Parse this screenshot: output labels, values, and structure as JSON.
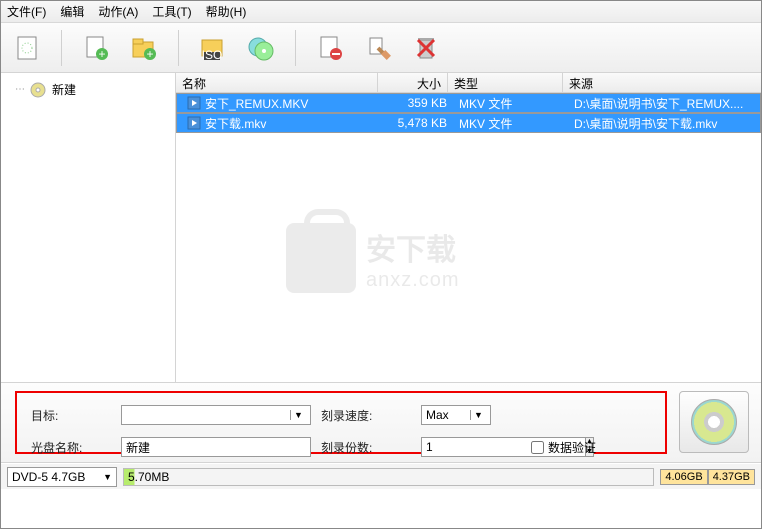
{
  "menu": {
    "file": "文件(F)",
    "edit": "编辑",
    "action": "动作(A)",
    "tools": "工具(T)",
    "help": "帮助(H)"
  },
  "sidebar": {
    "newProject": "新建"
  },
  "columns": {
    "name": "名称",
    "size": "大小",
    "type": "类型",
    "source": "来源"
  },
  "files": [
    {
      "name": "安下_REMUX.MKV",
      "size": "359 KB",
      "type": "MKV 文件",
      "source": "D:\\桌面\\说明书\\安下_REMUX....",
      "selected": true
    },
    {
      "name": "安下载.mkv",
      "size": "5,478 KB",
      "type": "MKV 文件",
      "source": "D:\\桌面\\说明书\\安下载.mkv",
      "selected": true
    }
  ],
  "watermark": {
    "text": "安下载",
    "sub": "anxz.com"
  },
  "opts": {
    "target": "目标:",
    "targetValue": "",
    "speed": "刻录速度:",
    "speedValue": "Max",
    "discName": "光盘名称:",
    "discNameValue": "新建",
    "copies": "刻录份数:",
    "copiesValue": "1",
    "verify": "数据验证"
  },
  "status": {
    "media": "DVD-5 4.7GB",
    "used": "5.70MB",
    "mark1": "4.06GB",
    "mark2": "4.37GB"
  }
}
